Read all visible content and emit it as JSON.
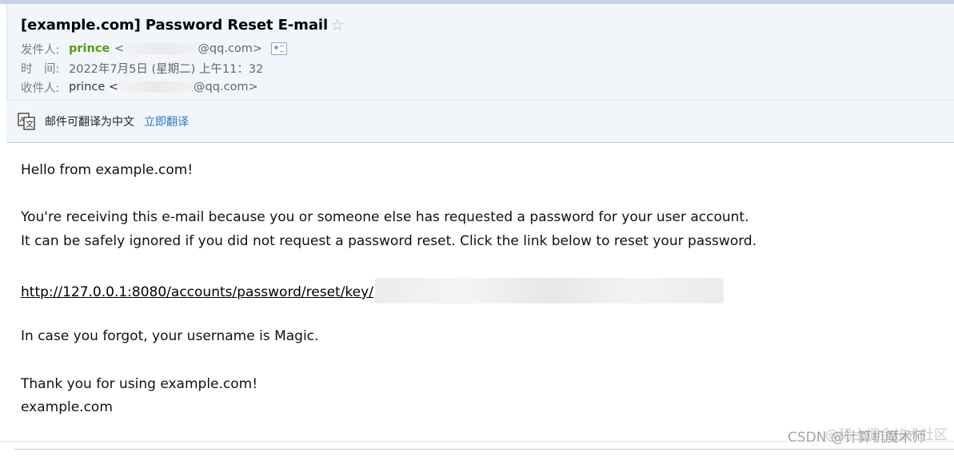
{
  "header": {
    "subject": "[example.com] Password Reset E-mail",
    "star_icon": "star-outline-icon",
    "sender_label": "发件人:",
    "sender_name": "prince",
    "sender_open": "<",
    "sender_domain": "@qq.com>",
    "contact_card_icon": "contact-card-icon",
    "time_label": "时　间:",
    "time_value": "2022年7月5日 (星期二) 上午11：32",
    "recipient_label": "收件人:",
    "recipient_name": "prince <",
    "recipient_domain": "@qq.com>"
  },
  "translate": {
    "icon": "translate-icon",
    "notice": "邮件可翻译为中文",
    "action": "立即翻译"
  },
  "email_body": {
    "greeting": "Hello from example.com!",
    "line1": "You're receiving this e-mail because you or someone else has requested a password for your user account.",
    "line2": "It can be safely ignored if you did not request a password reset. Click the link below to reset your password.",
    "reset_link": "http://127.0.0.1:8080/accounts/password/reset/key/",
    "username_line": "In case you forgot, your username is Magic.",
    "thanks": "Thank you for using example.com!",
    "signature": "example.com"
  },
  "watermark": {
    "primary": "CSDN @计算机魔术师",
    "secondary": "@稀土掘金技术社区"
  },
  "colors": {
    "sender_name": "#5a9b0f",
    "link": "#2a78c9",
    "header_bg": "#f2f6fb"
  }
}
